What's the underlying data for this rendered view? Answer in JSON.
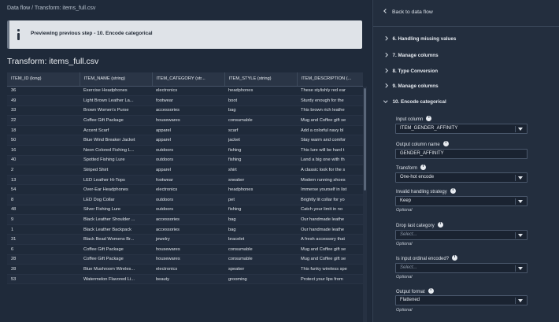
{
  "breadcrumb": "Data flow / Transform: items_full.csv",
  "banner": {
    "text": "Previewing previous step - 10. Encode categorical"
  },
  "transform_title": "Transform: items_full.csv",
  "table": {
    "columns": [
      "ITEM_ID (long)",
      "ITEM_NAME (string)",
      "ITEM_CATEGORY (str...",
      "ITEM_STYLE (string)",
      "ITEM_DESCRIPTION (..."
    ],
    "rows": [
      [
        "36",
        "Exercise Headphones",
        "electronics",
        "headphones",
        "These stylishly red ear"
      ],
      [
        "49",
        "Light Brown Leather La...",
        "footwear",
        "boot",
        "Sturdy enough for the"
      ],
      [
        "33",
        "Brown Women's Purse",
        "accessories",
        "bag",
        "This brown rich leathe"
      ],
      [
        "22",
        "Coffee Gift Package",
        "housewares",
        "consumable",
        "Mug and Coffee gift se"
      ],
      [
        "18",
        "Accent Scarf",
        "apparel",
        "scarf",
        "Add a colorful navy bl"
      ],
      [
        "50",
        "Blue Wind Breaker Jacket",
        "apparel",
        "jacket",
        "Stay warm and comfor"
      ],
      [
        "16",
        "Neon Colored Fishing L...",
        "outdoors",
        "fishing",
        "This lure will be hard t"
      ],
      [
        "40",
        "Spotted Fishing Lure",
        "outdoors",
        "fishing",
        "Land a big one with th"
      ],
      [
        "2",
        "Striped Shirt",
        "apparel",
        "shirt",
        "A classic look for the s"
      ],
      [
        "13",
        "LED Leather Hi-Tops",
        "footwear",
        "sneaker",
        "Modern running shoes"
      ],
      [
        "54",
        "Over-Ear Headphones",
        "electronics",
        "headphones",
        "Immerse yourself in list"
      ],
      [
        "8",
        "LED Dog Collar",
        "outdoors",
        "pet",
        "Brightly lit collar for yo"
      ],
      [
        "48",
        "Silver Fishing Lure",
        "outdoors",
        "fishing",
        "Catch your limit in no"
      ],
      [
        "9",
        "Black Leather Shoulder ...",
        "accessories",
        "bag",
        "Our handmade leathe"
      ],
      [
        "1",
        "Black Leather Backpack",
        "accessories",
        "bag",
        "Our handmade leathe"
      ],
      [
        "31",
        "Black Bead Womens Br...",
        "jewelry",
        "bracelet",
        "A fresh accessory that"
      ],
      [
        "6",
        "Coffee Gift Package",
        "housewares",
        "consumable",
        "Mug and Coffee gift se"
      ],
      [
        "28",
        "Coffee Gift Package",
        "housewares",
        "consumable",
        "Mug and Coffee gift se"
      ],
      [
        "28",
        "Blue Mushroom Wireles...",
        "electronics",
        "speaker",
        "This funky wireless spe"
      ],
      [
        "53",
        "Watermelon Flavored Li...",
        "beauty",
        "grooming",
        "Protect your lips from"
      ]
    ]
  },
  "panel": {
    "back_label": "Back to data flow",
    "steps": [
      "6. Handling missing values",
      "7. Manage columns",
      "8. Type Conversion",
      "9. Manage columns",
      "10. Encode categorical"
    ],
    "fields": {
      "input_column": {
        "label": "Input column",
        "value": "ITEM_GENDER_AFFINITY"
      },
      "output_column_name": {
        "label": "Output column name",
        "value": "GENDER_AFFINITY"
      },
      "transform": {
        "label": "Transform",
        "value": "One-hot encode"
      },
      "invalid_handling": {
        "label": "Invalid handling strategy",
        "value": "Keep",
        "note": "Optional"
      },
      "drop_last": {
        "label": "Drop last category",
        "placeholder": "Select...",
        "note": "Optional"
      },
      "is_input_ordinal": {
        "label": "Is input ordinal encoded?",
        "placeholder": "Select...",
        "note": "Optional"
      },
      "output_format": {
        "label": "Output format",
        "value": "Flattened",
        "note": "Optional"
      }
    }
  }
}
